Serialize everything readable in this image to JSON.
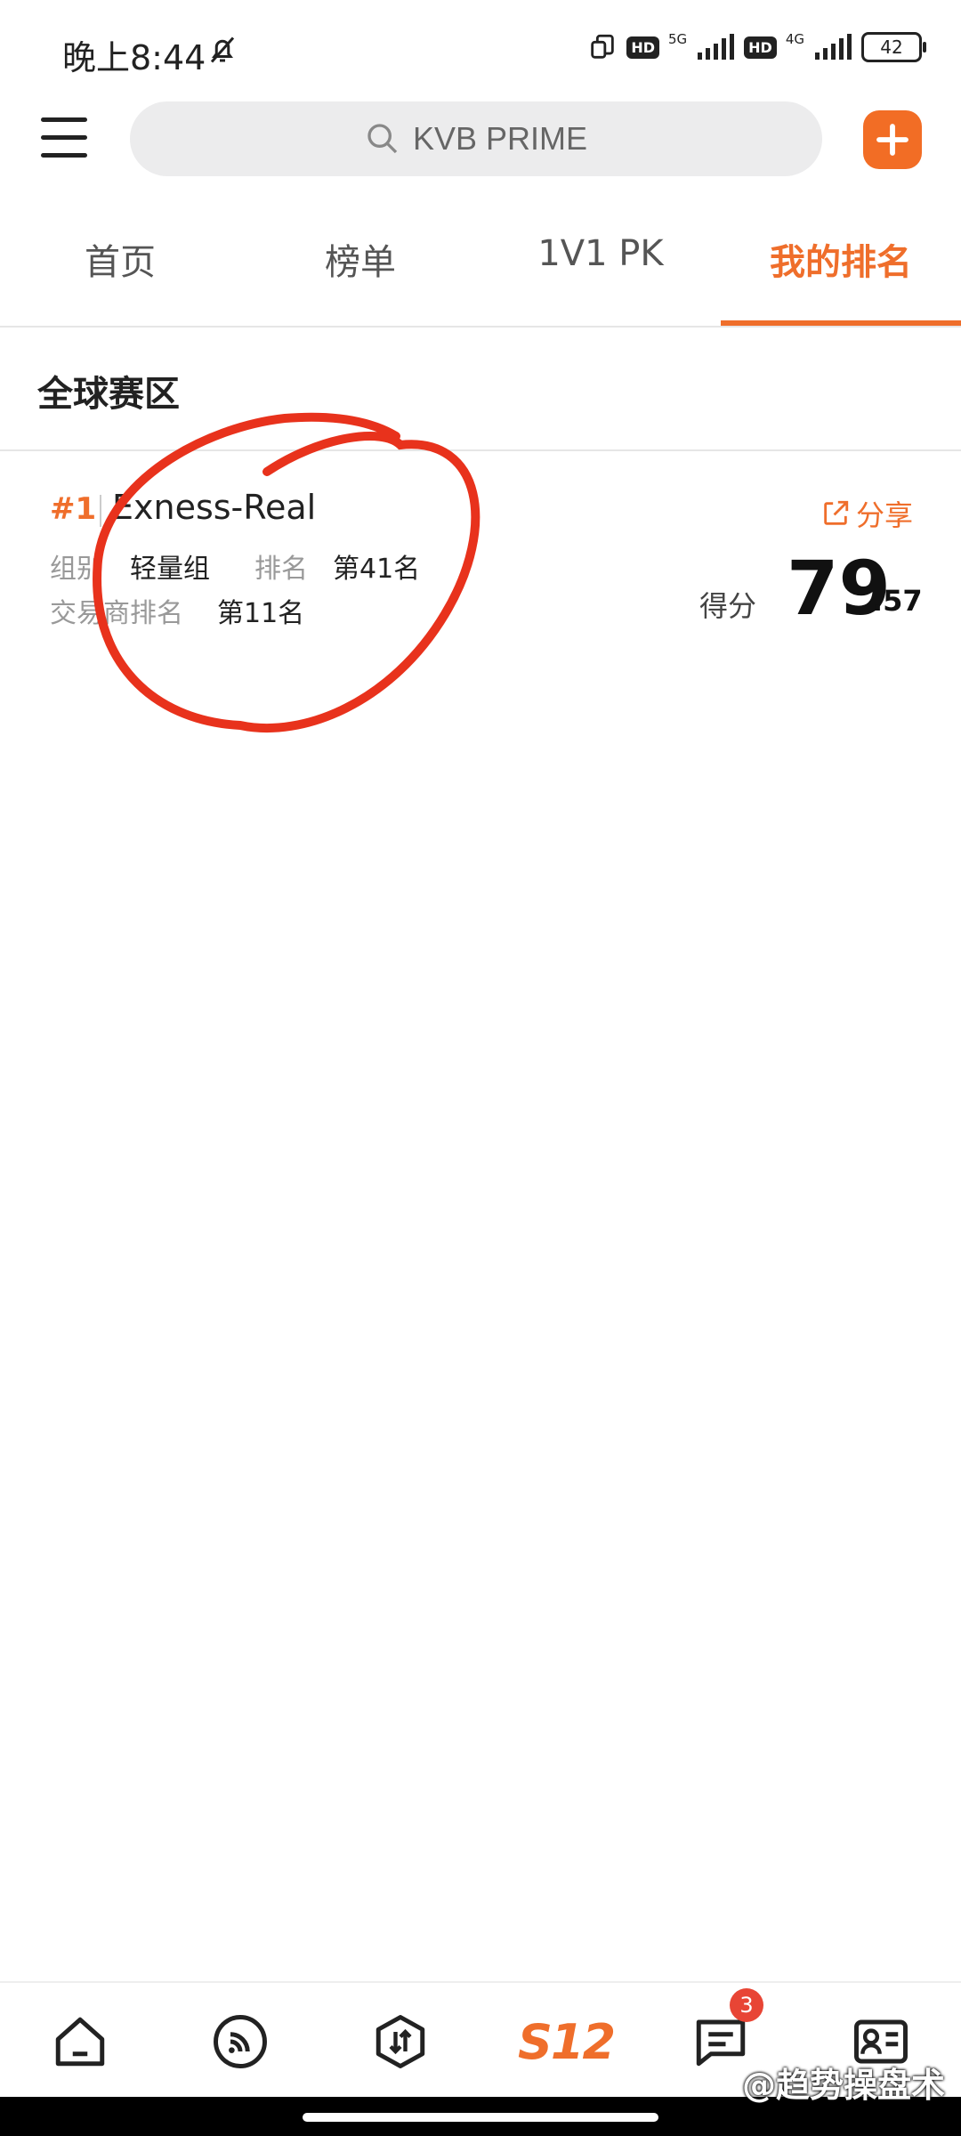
{
  "status_bar": {
    "time": "晚上8:44",
    "hd1": "HD",
    "net1": "5G",
    "hd2": "HD",
    "net2": "4G",
    "battery": "42"
  },
  "header": {
    "search_placeholder": "KVB PRIME"
  },
  "tabs": [
    {
      "label": "首页"
    },
    {
      "label": "榜单"
    },
    {
      "label": "1V1 PK"
    },
    {
      "label": "我的排名"
    }
  ],
  "section": {
    "title": "全球赛区"
  },
  "entry": {
    "rank": "#1",
    "account": "Exness-Real",
    "group_label": "组别",
    "group_value": "轻量组",
    "ranking_label": "排名",
    "ranking_value": "第41名",
    "broker_label": "交易商排名",
    "broker_value": "第11名",
    "share_label": "分享",
    "score_label": "得分",
    "score_int": "79",
    "score_dec": ".57"
  },
  "bottom_nav": {
    "s12_label": "S12",
    "messages_badge": "3"
  },
  "watermark": "@趋势操盘术",
  "colors": {
    "accent": "#ef6e2b",
    "annotation": "#e8321c"
  }
}
